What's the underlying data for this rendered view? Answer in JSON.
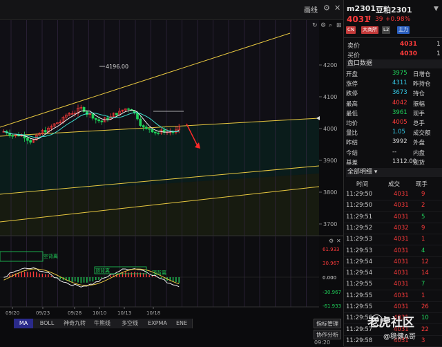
{
  "toolbar": {
    "label": "画线"
  },
  "quote": {
    "symbol": "m2301",
    "name": "豆粕2301",
    "price": "4031",
    "change": "39",
    "change_pct": "+0.98%",
    "badges": [
      "CN",
      "大商所",
      "L2",
      "主力"
    ],
    "colors": {
      "up": "#ff3b3b",
      "down": "#1fd15a",
      "neutral": "#d8d8d8",
      "cyan": "#35c9e6"
    }
  },
  "order_book": {
    "sell": {
      "label": "卖价",
      "price": "4031",
      "vol": "1"
    },
    "buy": {
      "label": "买价",
      "price": "4030",
      "vol": "1"
    }
  },
  "stats_header": "盘口数据",
  "stats": [
    {
      "l1": "开盘",
      "v1": "3975",
      "c1": "down",
      "l2": "日增仓",
      "v2": "",
      "c2": "neutral"
    },
    {
      "l1": "涨停",
      "v1": "4311",
      "c1": "cyan",
      "l2": "昨持仓",
      "v2": "",
      "c2": "neutral"
    },
    {
      "l1": "跌停",
      "v1": "3673",
      "c1": "cyan",
      "l2": "持仓",
      "v2": "",
      "c2": "neutral"
    },
    {
      "l1": "最高",
      "v1": "4042",
      "c1": "up",
      "l2": "振幅",
      "v2": "",
      "c2": "neutral"
    },
    {
      "l1": "最低",
      "v1": "3961",
      "c1": "down",
      "l2": "现手",
      "v2": "",
      "c2": "neutral"
    },
    {
      "l1": "均价",
      "v1": "4005",
      "c1": "up",
      "l2": "总手",
      "v2": "",
      "c2": "neutral"
    },
    {
      "l1": "量比",
      "v1": "1.05",
      "c1": "cyan",
      "l2": "成交额",
      "v2": "",
      "c2": "neutral"
    },
    {
      "l1": "昨结",
      "v1": "3992",
      "c1": "neutral",
      "l2": "外盘",
      "v2": "",
      "c2": "neutral"
    },
    {
      "l1": "今结",
      "v1": "--",
      "c1": "neutral",
      "l2": "内盘",
      "v2": "",
      "c2": "neutral"
    },
    {
      "l1": "基差",
      "v1": "1312.00",
      "c1": "neutral",
      "l2": "现货",
      "v2": "",
      "c2": "neutral"
    }
  ],
  "trades_header": "全部明细",
  "trades_cols": [
    "时间",
    "成交",
    "现手"
  ],
  "trades": [
    {
      "time": "11:29:50",
      "price": "4031",
      "vol": "9"
    },
    {
      "time": "11:29:50",
      "price": "4031",
      "vol": "2"
    },
    {
      "time": "11:29:51",
      "price": "4031",
      "vol": "5"
    },
    {
      "time": "11:29:52",
      "price": "4032",
      "vol": "9"
    },
    {
      "time": "11:29:53",
      "price": "4031",
      "vol": "1"
    },
    {
      "time": "11:29:53",
      "price": "4031",
      "vol": "4"
    },
    {
      "time": "11:29:54",
      "price": "4031",
      "vol": "12"
    },
    {
      "time": "11:29:54",
      "price": "4031",
      "vol": "14"
    },
    {
      "time": "11:29:55",
      "price": "4031",
      "vol": "7"
    },
    {
      "time": "11:29:55",
      "price": "4031",
      "vol": "1"
    },
    {
      "time": "11:29:55",
      "price": "4031",
      "vol": "26"
    },
    {
      "time": "11:29:56",
      "price": "4031",
      "vol": "10"
    },
    {
      "time": "11:29:57",
      "price": "4031",
      "vol": "22"
    },
    {
      "time": "11:29:58",
      "price": "4031",
      "vol": "3"
    }
  ],
  "chart_data": {
    "type": "line",
    "price_axis": {
      "ticks": [
        "4200",
        "4100",
        "4000",
        "3900",
        "3800",
        "3700"
      ],
      "current": "4031",
      "ylim": [
        3700,
        4200
      ]
    },
    "peak_label": "4196.00",
    "x_ticks": [
      "09/20",
      "09/23",
      "09/28",
      "10/10",
      "10/13",
      "10/18"
    ],
    "indicator_axis": {
      "ticks": [
        "61.933",
        "30.967",
        "0.000",
        "-30.967",
        "-61.933"
      ]
    },
    "annotations": [
      "空背离",
      "顶背离",
      "顶背离"
    ],
    "bottom_time": "09:20"
  },
  "bottom_tabs": [
    "MA",
    "BOLL",
    "神奇九转",
    "牛熊线",
    "多空线",
    "EXPMA",
    "ENE"
  ],
  "buttons": {
    "indicator_mgmt": "指标管理",
    "coop": "协作分析"
  },
  "watermark": {
    "title": "老虎社区",
    "user": "@稳健A哥"
  }
}
